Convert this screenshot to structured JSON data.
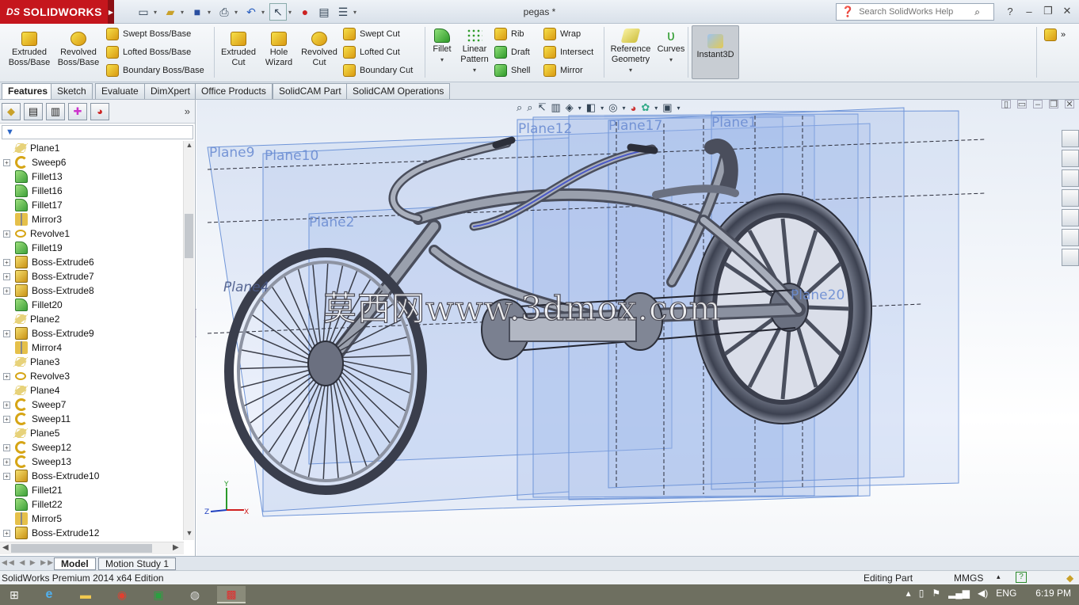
{
  "app": {
    "brand": "SOLIDWORKS",
    "document_title": "pegas *",
    "search_placeholder": "Search SolidWorks Help"
  },
  "ribbon": {
    "extruded_boss": [
      "Extruded",
      "Boss/Base"
    ],
    "revolved_boss": [
      "Revolved",
      "Boss/Base"
    ],
    "swept_boss": "Swept Boss/Base",
    "lofted_boss": "Lofted Boss/Base",
    "boundary_boss": "Boundary Boss/Base",
    "extruded_cut": [
      "Extruded",
      "Cut"
    ],
    "hole_wizard": [
      "Hole",
      "Wizard"
    ],
    "revolved_cut": [
      "Revolved",
      "Cut"
    ],
    "swept_cut": "Swept Cut",
    "lofted_cut": "Lofted Cut",
    "boundary_cut": "Boundary Cut",
    "fillet": "Fillet",
    "linear_pattern": [
      "Linear",
      "Pattern"
    ],
    "rib": "Rib",
    "draft": "Draft",
    "shell": "Shell",
    "wrap": "Wrap",
    "intersect": "Intersect",
    "mirror": "Mirror",
    "reference_geometry": [
      "Reference",
      "Geometry"
    ],
    "curves": "Curves",
    "instant3d": "Instant3D"
  },
  "command_tabs": [
    "Features",
    "Sketch",
    "Evaluate",
    "DimXpert",
    "Office Products",
    "SolidCAM Part",
    "SolidCAM Operations"
  ],
  "feature_tree": [
    {
      "label": "Plane1",
      "type": "plane",
      "expandable": false
    },
    {
      "label": "Sweep6",
      "type": "sweep",
      "expandable": true
    },
    {
      "label": "Fillet13",
      "type": "fillet",
      "expandable": false
    },
    {
      "label": "Fillet16",
      "type": "fillet",
      "expandable": false
    },
    {
      "label": "Fillet17",
      "type": "fillet",
      "expandable": false
    },
    {
      "label": "Mirror3",
      "type": "mirror",
      "expandable": false
    },
    {
      "label": "Revolve1",
      "type": "revolve",
      "expandable": true
    },
    {
      "label": "Fillet19",
      "type": "fillet",
      "expandable": false
    },
    {
      "label": "Boss-Extrude6",
      "type": "extrude",
      "expandable": true
    },
    {
      "label": "Boss-Extrude7",
      "type": "extrude",
      "expandable": true
    },
    {
      "label": "Boss-Extrude8",
      "type": "extrude",
      "expandable": true
    },
    {
      "label": "Fillet20",
      "type": "fillet",
      "expandable": false
    },
    {
      "label": "Plane2",
      "type": "plane",
      "expandable": false
    },
    {
      "label": "Boss-Extrude9",
      "type": "extrude",
      "expandable": true
    },
    {
      "label": "Mirror4",
      "type": "mirror",
      "expandable": false
    },
    {
      "label": "Plane3",
      "type": "plane",
      "expandable": false
    },
    {
      "label": "Revolve3",
      "type": "revolve",
      "expandable": true
    },
    {
      "label": "Plane4",
      "type": "plane",
      "expandable": false
    },
    {
      "label": "Sweep7",
      "type": "sweep",
      "expandable": true
    },
    {
      "label": "Sweep11",
      "type": "sweep",
      "expandable": true
    },
    {
      "label": "Plane5",
      "type": "plane",
      "expandable": false
    },
    {
      "label": "Sweep12",
      "type": "sweep",
      "expandable": true
    },
    {
      "label": "Sweep13",
      "type": "sweep",
      "expandable": true
    },
    {
      "label": "Boss-Extrude10",
      "type": "extrude",
      "expandable": true
    },
    {
      "label": "Fillet21",
      "type": "fillet",
      "expandable": false
    },
    {
      "label": "Fillet22",
      "type": "fillet",
      "expandable": false
    },
    {
      "label": "Mirror5",
      "type": "mirror",
      "expandable": false
    },
    {
      "label": "Boss-Extrude12",
      "type": "extrude",
      "expandable": true
    }
  ],
  "viewport": {
    "plane_labels": [
      "Plane9",
      "Plane10",
      "Plane2",
      "Plane1",
      "Plane12",
      "Plane17",
      "Plane20",
      "Plane4"
    ],
    "watermark": "莫西网www.3dmox.com",
    "axis": {
      "x": "X",
      "y": "Y",
      "z": "Z"
    }
  },
  "bottom_tabs": [
    "Model",
    "Motion Study 1"
  ],
  "status": {
    "edition": "SolidWorks Premium 2014 x64 Edition",
    "mode": "Editing Part",
    "units": "MMGS",
    "units_caret": "▴",
    "help": "?"
  },
  "taskbar": {
    "language": "ENG",
    "time": "6:19 PM"
  }
}
